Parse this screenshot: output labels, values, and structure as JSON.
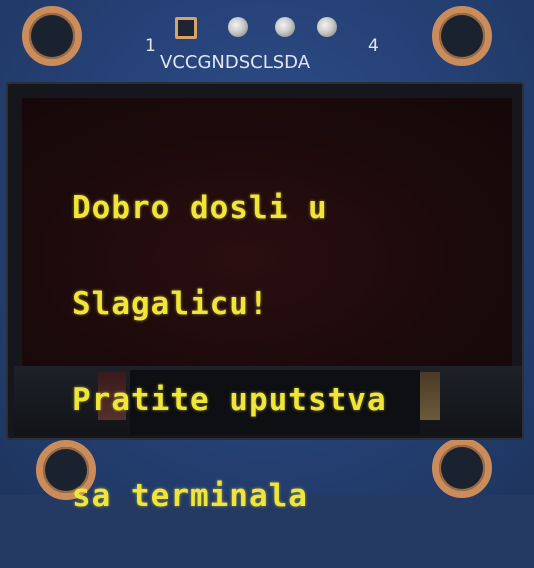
{
  "pins": {
    "label": "VCCGNDSCLSDA",
    "first_pin_number": "1",
    "last_pin_number": "4"
  },
  "display": {
    "lines": [
      "Dobro dosli u",
      "Slagalicu!",
      "Pratite uputstva",
      "sa terminala"
    ],
    "text_color": "#f0e63a"
  }
}
